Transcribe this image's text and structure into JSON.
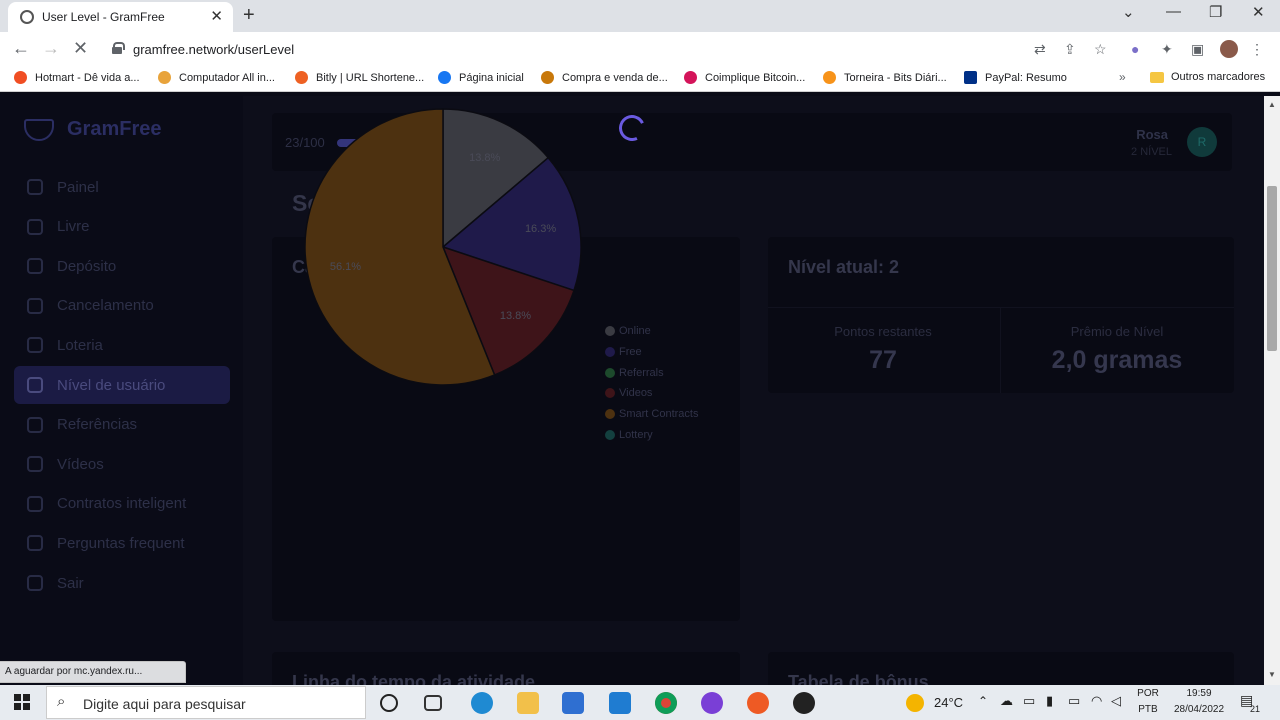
{
  "browser": {
    "tab_title": "User Level - GramFree",
    "url": "gramfree.network/userLevel",
    "bookmarks": [
      {
        "label": "Hotmart - Dê vida a...",
        "color": "#f04e23"
      },
      {
        "label": "Computador All in...",
        "color": "#e8a33b"
      },
      {
        "label": "Bitly | URL Shortene...",
        "color": "#ee6123"
      },
      {
        "label": "Página inicial",
        "color": "#1877f2"
      },
      {
        "label": "Compra e venda de...",
        "color": "#c8780a"
      },
      {
        "label": "Coimplique Bitcoin...",
        "color": "#d4145a"
      },
      {
        "label": "Torneira - Bits Diári...",
        "color": "#f7931a"
      },
      {
        "label": "PayPal: Resumo",
        "color": "#003087"
      }
    ],
    "bookmarks_more": "»",
    "other_bookmarks": "Outros marcadores",
    "status_text": "A aguardar por mc.yandex.ru..."
  },
  "sidebar": {
    "logo": "GramFree",
    "items": [
      {
        "label": "Painel",
        "active": false
      },
      {
        "label": "Livre",
        "active": false
      },
      {
        "label": "Depósito",
        "active": false
      },
      {
        "label": "Cancelamento",
        "active": false
      },
      {
        "label": "Loteria",
        "active": false
      },
      {
        "label": "Nível de usuário",
        "active": true
      },
      {
        "label": "Referências",
        "active": false
      },
      {
        "label": "Vídeos",
        "active": false
      },
      {
        "label": "Contratos inteligent",
        "active": false
      },
      {
        "label": "Perguntas frequent",
        "active": false
      },
      {
        "label": "Sair",
        "active": false
      }
    ]
  },
  "topbar": {
    "progress_label": "23/100",
    "progress_fraction": 0.23,
    "user_name": "Rosa",
    "user_level": "2 NÍVEL",
    "avatar_initial": "R"
  },
  "main": {
    "section_title": "Seu nível",
    "category_card_title": "Categoria",
    "level_card_title": "Nível atual: 2",
    "remaining_points_label": "Pontos restantes",
    "remaining_points_value": "77",
    "level_prize_label": "Prêmio de Nível",
    "level_prize_value": "2,0 gramas",
    "bottom_left_title": "Linha do tempo da atividade",
    "bottom_right_title": "Tabela de bônus"
  },
  "chart_data": {
    "type": "pie",
    "series": [
      {
        "name": "Online",
        "value": 13.8,
        "label": "13.8%",
        "color": "#3a3b42"
      },
      {
        "name": "Free",
        "value": 16.3,
        "label": "16.3%",
        "color": "#1f1a4a"
      },
      {
        "name": "Referrals",
        "value": 0,
        "label": "",
        "color": "#1d4a2c"
      },
      {
        "name": "Videos",
        "value": 13.8,
        "label": "13.8%",
        "color": "#3e1419"
      },
      {
        "name": "Smart Contracts",
        "value": 56.1,
        "label": "56.1%",
        "color": "#4d3110"
      },
      {
        "name": "Lottery",
        "value": 0,
        "label": "",
        "color": "#13403f"
      }
    ],
    "legend_placement": "right"
  },
  "taskbar": {
    "search_placeholder": "Digite aqui para pesquisar",
    "weather": "24°C",
    "language_top": "POR",
    "language_bottom": "PTB",
    "time": "19:59",
    "date": "28/04/2022",
    "notifications": "21"
  }
}
